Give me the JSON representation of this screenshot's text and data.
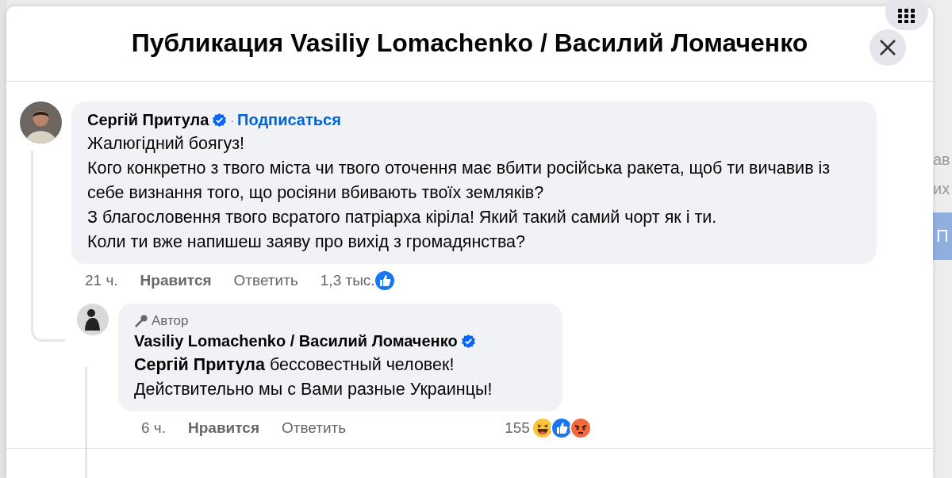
{
  "dialog": {
    "title": "Публикация Vasiliy Lomachenko / Василий Ломаченко"
  },
  "background": {
    "fragments": [
      "ав",
      "их"
    ],
    "button": "П"
  },
  "comment": {
    "author": "Сергій Притула",
    "verified": true,
    "separator": "·",
    "follow": "Подписаться",
    "lines": [
      "Жалюгідний боягуз!",
      "Кого конкретно з твого міста чи твого оточення має вбити російська ракета, щоб ти вичавив із себе визнання того, що росіяни вбивають твоїх земляків?",
      "З благословення твого всратого патріарха кіріла! Який такий самий чорт як і ти.",
      "Коли ти вже напишеш заяву про вихід з громадянства?"
    ],
    "time": "21 ч.",
    "like": "Нравится",
    "reply": "Ответить",
    "reaction_count": "1,3 тыс."
  },
  "reply": {
    "badge": "Автор",
    "author": "Vasiliy Lomachenko / Василий Ломаченко",
    "verified": true,
    "lines": [
      "**Сергій Притула** бессовестный человек!",
      "Действительно мы с Вами разные Украинцы!"
    ],
    "time": "6 ч.",
    "like": "Нравится",
    "reply": "Ответить",
    "reaction_count": "155"
  }
}
